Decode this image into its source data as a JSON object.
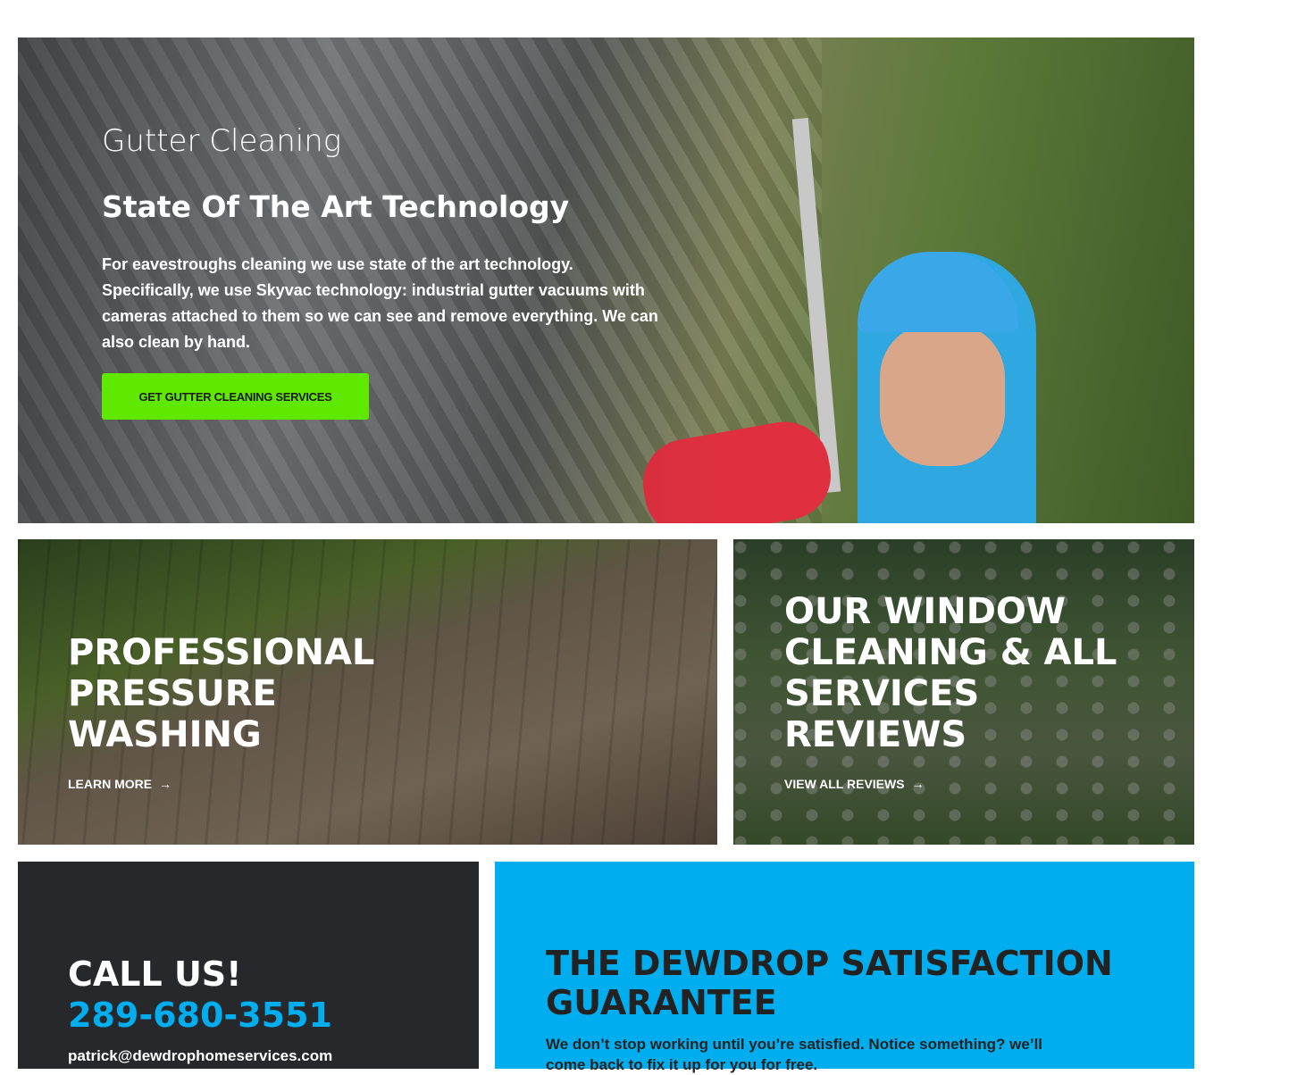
{
  "hero": {
    "subtitle": "Gutter Cleaning",
    "title": "State Of The Art Technology",
    "text": "For eavestroughs cleaning we use state of the art technology. Specifically, we use Skyvac technology: industrial gutter vacuums with cameras attached to them so we can see and remove everything. We can also clean by hand.",
    "button": "GET GUTTER CLEANING SERVICES",
    "button_color": "#5fe800"
  },
  "pressure": {
    "title": "PROFESSIONAL PRESSURE WASHING",
    "link": "LEARN MORE",
    "icon": "arrow-right-icon"
  },
  "reviews": {
    "title": "OUR WINDOW CLEANING & ALL SERVICES REVIEWS",
    "link": "VIEW ALL REVIEWS",
    "icon": "arrow-right-icon"
  },
  "call": {
    "heading": "CALL US!",
    "phone": "289-680-3551",
    "email": "patrick@dewdrophomeservices.com"
  },
  "guarantee": {
    "heading": "THE DEWDROP SATISFACTION GUARANTEE",
    "text": "We don’t stop working until you’re satisfied. Notice something? we’ll come back to fix it up for you for free."
  },
  "colors": {
    "accent": "#00aeef",
    "dark": "#27282c"
  }
}
